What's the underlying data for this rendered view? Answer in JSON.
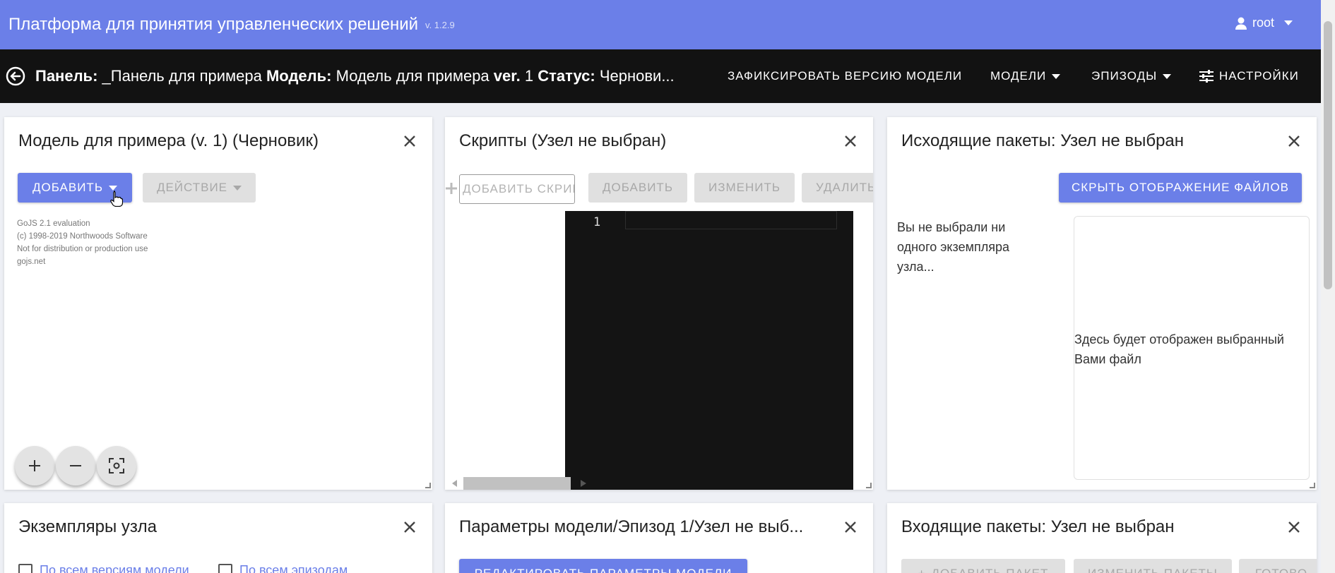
{
  "app": {
    "title": "Платформа для принятия управленческих решений",
    "version": "v. 1.2.9",
    "user": "root"
  },
  "toolbar": {
    "panel_label": "Панель:",
    "panel_value": "_Панель для примера",
    "model_label": "Модель:",
    "model_value": "Модель для примера",
    "ver_label": "ver.",
    "ver_value": "1",
    "status_label": "Статус:",
    "status_value": "Чернови...",
    "fix_version": "ЗАФИКСИРОВАТЬ ВЕРСИЮ МОДЕЛИ",
    "models": "МОДЕЛИ",
    "episodes": "ЭПИЗОДЫ",
    "settings": "НАСТРОЙКИ"
  },
  "panels": {
    "model": {
      "title": "Модель для примера (v. 1) (Черновик)",
      "add_button": "ДОБАВИТЬ",
      "action_button": "ДЕЙСТВИЕ",
      "gojs_lines": [
        "GoJS 2.1 evaluation",
        "(c) 1998-2019 Northwoods Software",
        "Not for distribution or production use",
        "gojs.net"
      ]
    },
    "scripts": {
      "title": "Скрипты (Узел не выбран)",
      "script_placeholder": "ДОБАВИТЬ СКРИПТ",
      "add_button": "ДОБАВИТЬ",
      "edit_button": "ИЗМЕНИТЬ",
      "delete_button": "УДАЛИТЬ",
      "line_number": "1"
    },
    "outgoing": {
      "title": "Исходящие пакеты: Узел не выбран",
      "hide_files_button": "СКРЫТЬ ОТОБРАЖЕНИЕ ФАЙЛОВ",
      "no_node_text": "Вы не выбрали ни одного экземпляра узла...",
      "file_placeholder": "Здесь будет отображен выбранный Вами файл"
    },
    "instances": {
      "title": "Экземпляры узла",
      "checkbox_all_versions": "По всем версиям модели",
      "checkbox_all_episodes": "По всем эпизодам"
    },
    "params": {
      "title": "Параметры модели/Эпизод 1/Узел не выб...",
      "edit_button": "РЕДАКТИРОВАТЬ ПАРАМЕТРЫ МОДЕЛИ"
    },
    "incoming": {
      "title": "Входящие пакеты: Узел не выбран",
      "add_button": "ДОБАВИТЬ ПАКЕТ",
      "edit_button": "ИЗМЕНИТЬ ПАКЕТЫ",
      "ready_button": "ГОТОВО"
    }
  },
  "colors": {
    "primary": "#6b7fe8",
    "toolbar_bg": "#121212",
    "editor_bg": "#141414"
  }
}
